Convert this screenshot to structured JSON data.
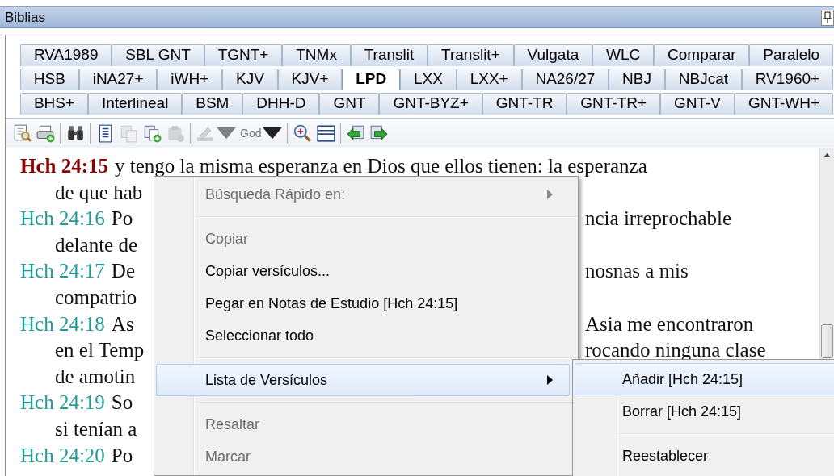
{
  "window": {
    "title": "Biblias"
  },
  "tab_rows": [
    [
      {
        "label": "RVA1989",
        "selected": false
      },
      {
        "label": "SBL GNT",
        "selected": false
      },
      {
        "label": "TGNT+",
        "selected": false
      },
      {
        "label": "TNMx",
        "selected": false
      },
      {
        "label": "Translit",
        "selected": false
      },
      {
        "label": "Translit+",
        "selected": false
      },
      {
        "label": "Vulgata",
        "selected": false
      },
      {
        "label": "WLC",
        "selected": false
      },
      {
        "label": "Comparar",
        "selected": false
      },
      {
        "label": "Paralelo",
        "selected": false
      }
    ],
    [
      {
        "label": "HSB",
        "selected": false
      },
      {
        "label": "iNA27+",
        "selected": false
      },
      {
        "label": "iWH+",
        "selected": false
      },
      {
        "label": "KJV",
        "selected": false
      },
      {
        "label": "KJV+",
        "selected": false
      },
      {
        "label": "LPD",
        "selected": true
      },
      {
        "label": "LXX",
        "selected": false
      },
      {
        "label": "LXX+",
        "selected": false
      },
      {
        "label": "NA26/27",
        "selected": false
      },
      {
        "label": "NBJ",
        "selected": false
      },
      {
        "label": "NBJcat",
        "selected": false
      },
      {
        "label": "RV1960+",
        "selected": false
      }
    ],
    [
      {
        "label": "BHS+",
        "selected": false
      },
      {
        "label": "Interlineal",
        "selected": false
      },
      {
        "label": "BSM",
        "selected": false
      },
      {
        "label": "DHH-D",
        "selected": false
      },
      {
        "label": "GNT",
        "selected": false
      },
      {
        "label": "GNT-BYZ+",
        "selected": false
      },
      {
        "label": "GNT-TR",
        "selected": false
      },
      {
        "label": "GNT-TR+",
        "selected": false
      },
      {
        "label": "GNT-V",
        "selected": false
      },
      {
        "label": "GNT-WH+",
        "selected": false
      }
    ]
  ],
  "toolbar": [
    {
      "kind": "button",
      "disabled": false
    },
    {
      "kind": "button",
      "disabled": false
    },
    {
      "kind": "separator"
    },
    {
      "kind": "button",
      "disabled": false
    },
    {
      "kind": "separator"
    },
    {
      "kind": "button",
      "disabled": false
    },
    {
      "kind": "button",
      "disabled": true
    },
    {
      "kind": "button",
      "disabled": false
    },
    {
      "kind": "button",
      "disabled": true
    },
    {
      "kind": "separator"
    },
    {
      "kind": "dropdown",
      "disabled": true
    },
    {
      "kind": "text-dropdown",
      "label": "God",
      "disabled": true
    },
    {
      "kind": "separator"
    },
    {
      "kind": "button",
      "disabled": false
    },
    {
      "kind": "button",
      "disabled": false
    },
    {
      "kind": "separator"
    },
    {
      "kind": "button",
      "disabled": false
    },
    {
      "kind": "button",
      "disabled": false
    }
  ],
  "verses": [
    {
      "ref": "Hch 24:15",
      "selected": true,
      "lines": [
        {
          "left": "y tengo la misma esperanza en Dios que ellos tienen: la esperanza"
        },
        {
          "left": "de que hab"
        }
      ]
    },
    {
      "ref": "Hch 24:16",
      "selected": false,
      "lines": [
        {
          "left": "Po",
          "right": "ncia irreprochable"
        },
        {
          "left": "delante de"
        }
      ]
    },
    {
      "ref": "Hch 24:17",
      "selected": false,
      "lines": [
        {
          "left": "De",
          "right": "nosnas a mis"
        },
        {
          "left": "compatrio"
        }
      ]
    },
    {
      "ref": "Hch 24:18",
      "selected": false,
      "lines": [
        {
          "left": "As",
          "right": "Asia me encontraron"
        },
        {
          "left": "en el Temp",
          "right": "rocando ninguna clase"
        },
        {
          "left": "de amotin"
        }
      ]
    },
    {
      "ref": "Hch 24:19",
      "selected": false,
      "lines": [
        {
          "left": "So"
        },
        {
          "left": "si tenían a"
        }
      ]
    },
    {
      "ref": "Hch 24:20",
      "selected": false,
      "lines": [
        {
          "left": "Po"
        }
      ]
    }
  ],
  "context_menu": {
    "items": [
      {
        "kind": "item",
        "label": "Búsqueda Rápido en:",
        "disabled": true,
        "submenu": true,
        "selected": false
      },
      {
        "kind": "separator"
      },
      {
        "kind": "item",
        "label": "Copiar",
        "disabled": true,
        "submenu": false,
        "selected": false
      },
      {
        "kind": "item",
        "label": "Copiar versículos...",
        "disabled": false,
        "submenu": false,
        "selected": false
      },
      {
        "kind": "item",
        "label": "Pegar en Notas de Estudio [Hch 24:15]",
        "disabled": false,
        "submenu": false,
        "selected": false
      },
      {
        "kind": "item",
        "label": "Seleccionar todo",
        "disabled": false,
        "submenu": false,
        "selected": false
      },
      {
        "kind": "separator"
      },
      {
        "kind": "item",
        "label": "Lista de Versículos",
        "disabled": false,
        "submenu": true,
        "selected": true
      },
      {
        "kind": "separator"
      },
      {
        "kind": "item",
        "label": "Resaltar",
        "disabled": true,
        "submenu": false,
        "selected": false
      },
      {
        "kind": "item",
        "label": "Marcar",
        "disabled": true,
        "submenu": false,
        "selected": false
      }
    ]
  },
  "submenu": {
    "items": [
      {
        "kind": "item",
        "label": "Añadir [Hch 24:15]",
        "disabled": false,
        "submenu": false,
        "selected": true
      },
      {
        "kind": "item",
        "label": "Borrar [Hch 24:15]",
        "disabled": false,
        "submenu": false,
        "selected": false
      },
      {
        "kind": "separator"
      },
      {
        "kind": "item",
        "label": "Reestablecer",
        "disabled": false,
        "submenu": false,
        "selected": false
      }
    ]
  }
}
